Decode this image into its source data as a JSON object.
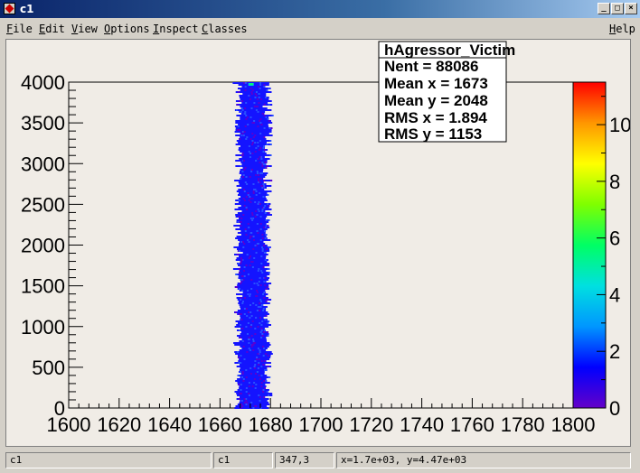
{
  "window": {
    "title": "c1"
  },
  "menu": [
    {
      "ul": "F",
      "rest": "ile"
    },
    {
      "ul": "E",
      "rest": "dit"
    },
    {
      "ul": "V",
      "rest": "iew"
    },
    {
      "ul": "O",
      "rest": "ptions"
    },
    {
      "ul": "I",
      "rest": "nspect"
    },
    {
      "ul": "C",
      "rest": "lasses"
    }
  ],
  "help": {
    "ul": "H",
    "rest": "elp"
  },
  "stats": {
    "name": "hAgressor_Victim",
    "lines": [
      {
        "label": "Nent = ",
        "value": "88086"
      },
      {
        "label": "Mean x = ",
        "value": "1673"
      },
      {
        "label": "Mean y = ",
        "value": "2048"
      },
      {
        "label": "RMS x = ",
        "value": "1.894"
      },
      {
        "label": "RMS y = ",
        "value": "1153"
      }
    ]
  },
  "chart_data": {
    "type": "heatmap",
    "xlim": [
      1600,
      1800
    ],
    "ylim": [
      0,
      4000
    ],
    "x_ticks": [
      1600,
      1620,
      1640,
      1660,
      1680,
      1700,
      1720,
      1740,
      1760,
      1780,
      1800
    ],
    "x_tick_labels": [
      "1600",
      "1620",
      "1640",
      "1660",
      "1680",
      "1700",
      "1720",
      "1740",
      "1760",
      "1780",
      "1800"
    ],
    "y_ticks": [
      0,
      500,
      1000,
      1500,
      2000,
      2500,
      3000,
      3500,
      4000
    ],
    "y_tick_labels": [
      "0",
      "500",
      "1000",
      "1500",
      "2000",
      "2500",
      "3000",
      "3500",
      "4000"
    ],
    "z_ticks": [
      0,
      2,
      4,
      6,
      8,
      10
    ],
    "z_tick_labels": [
      "0",
      "2",
      "4",
      "6",
      "8",
      "10"
    ],
    "zlim": [
      0,
      11.5
    ],
    "band": {
      "x_center": 1673,
      "x_halfwidth": 6,
      "y_range": [
        0,
        4000
      ]
    },
    "colors": {
      "palette": [
        "#6400c8",
        "#0000ff",
        "#0096ff",
        "#00e0e0",
        "#00ff64",
        "#7fff00",
        "#ffff00",
        "#ff9600",
        "#ff0000"
      ]
    }
  },
  "status": {
    "cells": [
      "c1",
      "c1",
      "347,3",
      "x=1.7e+03, y=4.47e+03"
    ]
  }
}
